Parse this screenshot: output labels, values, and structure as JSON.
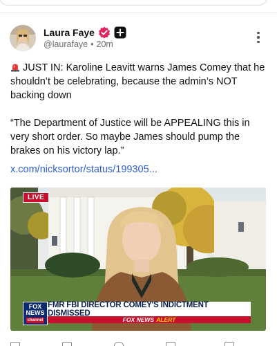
{
  "post": {
    "author": {
      "display_name": "Laura Faye",
      "handle": "@laurafaye",
      "separator": "•",
      "time_ago": "20m",
      "badges": [
        "verified-check-icon",
        "plus-icon"
      ]
    },
    "text": {
      "line1": "JUST IN: Karoline Leavitt warns James Comey that he shouldn’t be celebrating, because the admin’s NOT backing down",
      "line2": "“The Department of Justice will be APPEALING this in very short order. So maybe James should pump the brakes on his victory lap.”",
      "leading_icon": "rotating-light-icon"
    },
    "link": "x.com/nicksortor/status/199305...",
    "media": {
      "live_label": "LIVE",
      "network_logo_top": "FOX",
      "network_logo_mid": "NEWS",
      "network_logo_sub": "channel",
      "headline": "FMR FBI DIRECTOR COMEY'S INDICTMENT DISMISSED",
      "alert_prefix": "FOX NEWS",
      "alert_word": "ALERT"
    }
  },
  "colors": {
    "link": "#2f5fd0",
    "verified_badge": "#e0245e",
    "fox_red": "#c8102e",
    "fox_blue": "#0a2a6b"
  }
}
